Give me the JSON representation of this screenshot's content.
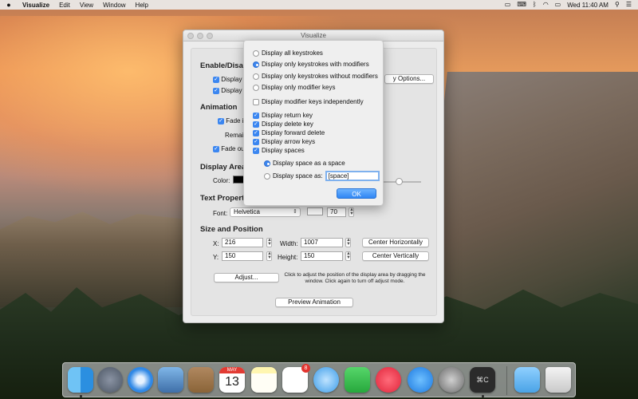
{
  "menubar": {
    "apple": "",
    "app_name": "Visualize",
    "menus": [
      "Edit",
      "View",
      "Window",
      "Help"
    ],
    "clock": "Wed 11:40 AM"
  },
  "window": {
    "title": "Visualize",
    "sections": {
      "enable": "Enable/Disab",
      "animation": "Animation",
      "display_area": "Display Area",
      "text_properties": "Text Propert",
      "size_position": "Size and Position"
    },
    "enable_rows": [
      "Display",
      "Display"
    ],
    "options_button": "y Options...",
    "animation_rows": {
      "fade_in": "Fade i",
      "remain": "Remai",
      "fade_out": "Fade ou"
    },
    "color_label": "Color:",
    "font_label": "Font:",
    "font_value": "Helvetica",
    "font_size": "70",
    "x_label": "X:",
    "x_value": "216",
    "y_label": "Y:",
    "y_value": "150",
    "width_label": "Width:",
    "width_value": "1007",
    "height_label": "Height:",
    "height_value": "150",
    "center_h": "Center Horizontally",
    "center_v": "Center Vertically",
    "adjust_button": "Adjust...",
    "adjust_hint": "Click to adjust the position of the display area by dragging the window. Click again to turn off adjust mode.",
    "preview_button": "Preview Animation"
  },
  "popover": {
    "radio_options": [
      {
        "label": "Display all keystrokes",
        "selected": false
      },
      {
        "label": "Display only keystrokes with modifiers",
        "selected": true
      },
      {
        "label": "Display only keystrokes without modifiers",
        "selected": false
      },
      {
        "label": "Display only modifier keys",
        "selected": false
      }
    ],
    "modifier_independent": {
      "label": "Display modifier keys independently",
      "checked": false
    },
    "checks": [
      {
        "label": "Display return key",
        "checked": true
      },
      {
        "label": "Display delete key",
        "checked": true
      },
      {
        "label": "Display forward delete",
        "checked": true
      },
      {
        "label": "Display arrow keys",
        "checked": true
      },
      {
        "label": "Display spaces",
        "checked": true
      }
    ],
    "space_as_space": "Display space as a space",
    "space_as": "Display space as:",
    "space_value": "[space]",
    "ok": "OK"
  },
  "dock": {
    "calendar_month": "MAY",
    "calendar_day": "13",
    "reminders_badge": "8",
    "console_label": "⌘C",
    "items": [
      "finder-icon",
      "launchpad-icon",
      "safari-icon",
      "mail-icon",
      "contacts-icon",
      "calendar-icon",
      "notes-icon",
      "reminders-icon",
      "messages-icon",
      "facetime-icon",
      "itunes-icon",
      "appstore-icon",
      "preferences-icon",
      "console-icon",
      "downloads-icon",
      "trash-icon"
    ]
  },
  "colors": {
    "accent": "#3b86f0",
    "window_bg": "#ececec"
  }
}
